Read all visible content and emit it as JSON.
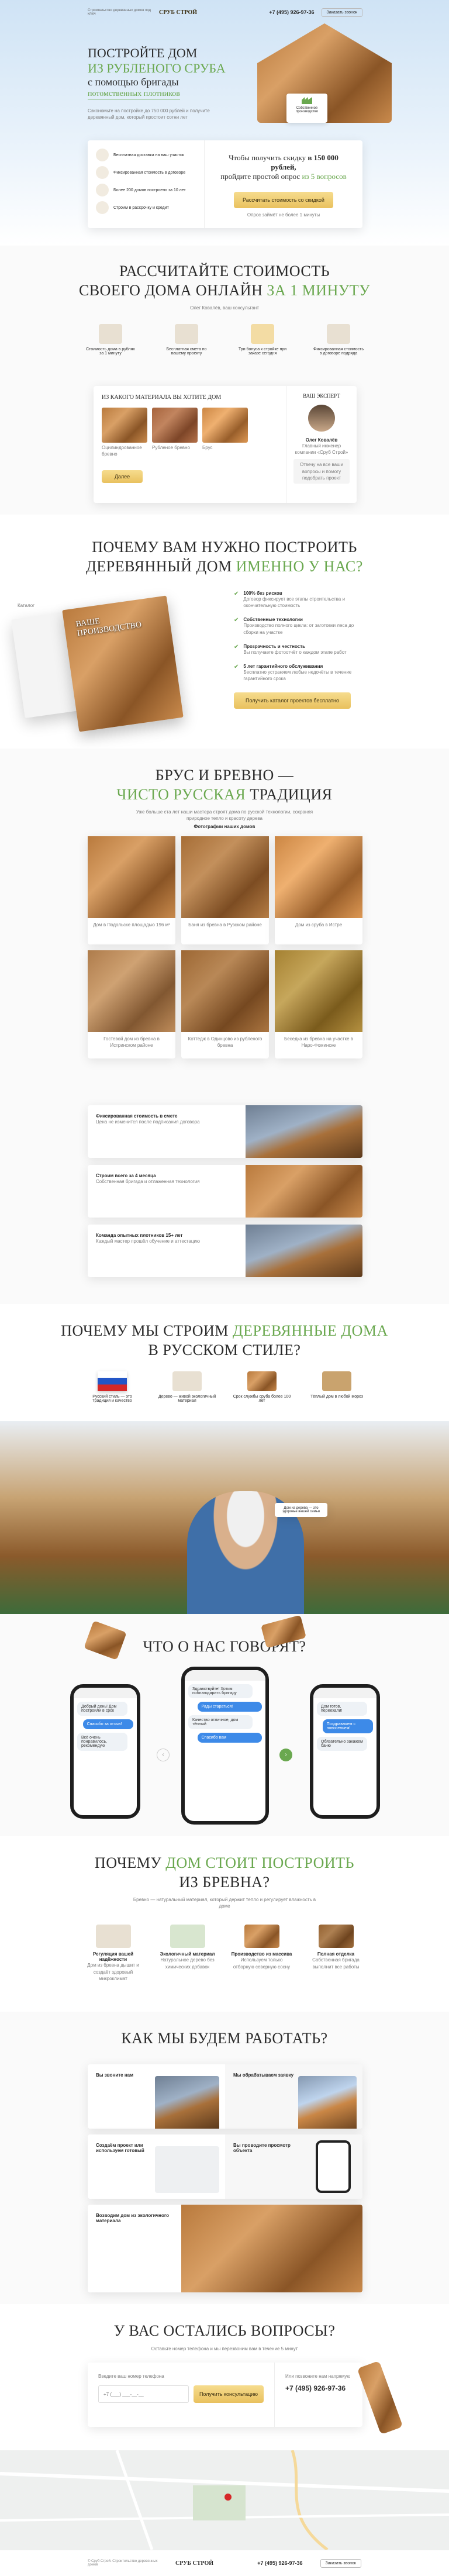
{
  "header": {
    "logo_text": "СРУБ СТРОЙ",
    "tagline": "Строительство деревянных домов под ключ",
    "phone": "+7 (495) 926-97-36",
    "callback_label": "Заказать звонок"
  },
  "hero": {
    "title_1": "ПОСТРОЙТЕ ДОМ",
    "title_2": "ИЗ РУБЛЕНОГО СРУБА",
    "title_3": "с помощью бригады",
    "title_4": "потомственных плотников",
    "subtitle": "Сэкономьте на постройке до 750 000 рублей и получите деревянный дом, который простоит сотни лет",
    "badge": "Собственное производство",
    "benefits": [
      {
        "icon": "axe-icon",
        "text": "Бесплатная доставка на ваш участок"
      },
      {
        "icon": "shield-icon",
        "text": "Фиксированная стоимость в договоре"
      },
      {
        "icon": "house-icon",
        "text": "Более 200 домов построено за 10 лет"
      },
      {
        "icon": "ruble-icon",
        "text": "Строим в рассрочку и кредит"
      }
    ],
    "gift_text_1": "Чтобы получить скидку",
    "gift_accent": "в 150 000 рублей,",
    "gift_text_2": "пройдите простой опрос",
    "gift_accent_2": "из 5 вопросов",
    "gift_button": "Рассчитать стоимость со скидкой",
    "gift_note": "Опрос займёт не более 1 минуты"
  },
  "calc": {
    "title": "РАССЧИТАЙТЕ СТОИМОСТЬ",
    "title_2": "СВОЕГО ДОМА ОНЛАЙН",
    "title_accent": "ЗА 1 МИНУТУ",
    "manager": "Олег Ковалёв, ваш консультант",
    "features": [
      {
        "icon": "calculator-icon",
        "text": "Стоимость дома в рублях за 1 минуту"
      },
      {
        "icon": "estimate-icon",
        "text": "Бесплатная смета по вашему проекту"
      },
      {
        "icon": "gift-icon",
        "text": "Три бонуса к стройке при заказе сегодня"
      },
      {
        "icon": "clipboard-icon",
        "text": "Фиксированная стоимость в договоре подряда"
      }
    ],
    "question": "ИЗ КАКОГО МАТЕРИАЛА ВЫ ХОТИТЕ ДОМ",
    "options": [
      "Оцилиндрованное бревно",
      "Рубленое бревно",
      "Брус"
    ],
    "next_label": "Далее",
    "expert_title": "ВАШ ЭКСПЕРТ",
    "expert_name": "Олег Ковалёв",
    "expert_role": "Главный инженер компании «Сруб Строй»",
    "expert_text": "Отвечу на все ваши вопросы и помогу подобрать проект"
  },
  "why": {
    "title": "ПОЧЕМУ ВАМ НУЖНО ПОСТРОИТЬ",
    "title_2": "ДЕРЕВЯННЫЙ ДОМ",
    "title_accent": "ИМЕННО У НАС?",
    "catalog_label": "Каталог",
    "book_title": "ВАШЕ ПРОИЗВОДСТВО",
    "items": [
      {
        "title": "100% без рисков",
        "text": "Договор фиксирует все этапы строительства и окончательную стоимость"
      },
      {
        "title": "Собственные технологии",
        "text": "Производство полного цикла: от заготовки леса до сборки на участке"
      },
      {
        "title": "Прозрачность и честность",
        "text": "Вы получаете фотоотчёт о каждом этапе работ"
      },
      {
        "title": "5 лет гарантийного обслуживания",
        "text": "Бесплатно устраняем любые недочёты в течение гарантийного срока"
      }
    ],
    "button": "Получить каталог проектов бесплатно"
  },
  "tradition": {
    "title": "БРУС И БРЕВНО —",
    "title_accent": "ЧИСТО РУССКАЯ",
    "title_end": "ТРАДИЦИЯ",
    "text": "Уже больше ста лет наши мастера строят дома по русской технологии, сохраняя природное тепло и красоту дерева",
    "subtitle": "Фотографии наших домов",
    "gallery": [
      "Дом в Подольске площадью 196 м²",
      "Баня из бревна в Рузском районе",
      "Дом из сруба в Истре",
      "Гостевой дом из бревна в Истринском районе",
      "Коттедж в Одинцово из рубленого бревна",
      "Беседка из бревна на участке в Наро-Фоминске"
    ],
    "steps": [
      {
        "title": "Фиксированная стоимость в смете",
        "text": "Цена не изменится после подписания договора"
      },
      {
        "title": "Строим всего за 4 месяца",
        "text": "Собственная бригада и отлаженная технология"
      },
      {
        "title": "Команда опытных плотников 15+ лет",
        "text": "Каждый мастер прошёл обучение и аттестацию"
      }
    ]
  },
  "russian": {
    "title": "ПОЧЕМУ МЫ СТРОИМ",
    "title_accent": "ДЕРЕВЯННЫЕ ДОМА",
    "title_2": "В РУССКОМ СТИЛЕ?",
    "points": [
      "Русский стиль — это традиция и качество",
      "Дерево — живой экологичный материал",
      "Срок службы сруба более 100 лет",
      "Тёплый дом в любой мороз"
    ],
    "note": "Дом из дерева — это здоровье вашей семьи"
  },
  "reviews": {
    "title": "ЧТО О НАС ГОВОРЯТ?",
    "chats": [
      [
        "Добрый день! Дом построили в срок",
        "Спасибо за отзыв!",
        "Всё очень понравилось, рекомендую"
      ],
      [
        "Здравствуйте! Хотим поблагодарить бригаду",
        "Рады стараться!",
        "Качество отличное, дом тёплый",
        "Спасибо вам"
      ],
      [
        "Дом готов, переехали!",
        "Поздравляем с новосельем!",
        "Обязательно закажем баню"
      ]
    ]
  },
  "log": {
    "title": "ПОЧЕМУ",
    "title_accent": "ДОМ СТОИТ ПОСТРОИТЬ",
    "title_2": "ИЗ БРЕВНА?",
    "text": "Бревно — натуральный материал, который держит тепло и регулирует влажность в доме",
    "features": [
      {
        "title": "Регуляция вашей надёжности",
        "text": "Дом из бревна дышит и создаёт здоровый микроклимат"
      },
      {
        "title": "Экологичный материал",
        "text": "Натуральное дерево без химических добавок"
      },
      {
        "title": "Производство из массива",
        "text": "Используем только отборную северную сосну"
      },
      {
        "title": "Полная отделка",
        "text": "Собственная бригада выполнит все работы"
      }
    ]
  },
  "how": {
    "title": "КАК МЫ БУДЕМ РАБОТАТЬ?",
    "steps": [
      {
        "left": "Вы звоните нам",
        "right": "Мы обрабатываем заявку"
      },
      {
        "left": "Создаём проект или используем готовый",
        "right": "Вы проводите просмотр объекта"
      },
      {
        "left": "Возводим дом из экологичного материала",
        "right": ""
      }
    ]
  },
  "contact": {
    "title": "У ВАС ОСТАЛИСЬ ВОПРОСЫ?",
    "text": "Оставьте номер телефона и мы перезвоним вам в течение 5 минут",
    "field_label": "Введите ваш номер телефона",
    "input_placeholder": "+7 (___) ___-__-__",
    "submit": "Получить консультацию",
    "or_call": "Или позвоните нам напрямую",
    "phone": "+7 (495) 926-97-36"
  },
  "footer": {
    "copyright": "© Сруб Строй. Строительство деревянных домов",
    "logo_text": "СРУБ СТРОЙ",
    "phone": "+7 (495) 926-97-36",
    "callback_label": "Заказать звонок"
  },
  "colors": {
    "accent": "#6aa84f",
    "gold": "#e9c15e",
    "text": "#2b2b2b"
  }
}
